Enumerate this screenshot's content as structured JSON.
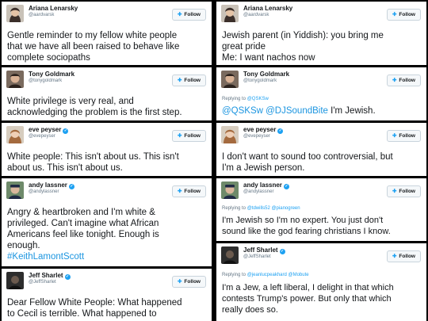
{
  "follow_label": "Follow",
  "left": [
    {
      "name": "Ariana Lenarsky",
      "handle": "@aardvarsk",
      "verified": false,
      "text_lines": [
        "Gentle reminder to my fellow white people",
        "that we have all been raised to behave like",
        "complete sociopaths"
      ]
    },
    {
      "name": "Tony Goldmark",
      "handle": "@tonygoldmark",
      "verified": false,
      "text_lines": [
        "White privilege is very real, and",
        "acknowledging the problem is the first step."
      ]
    },
    {
      "name": "eve peyser",
      "handle": "@evepeyser",
      "verified": true,
      "text_lines": [
        "White people: This isn't about us. This isn't",
        "about us. This isn't about us."
      ]
    },
    {
      "name": "andy lassner",
      "handle": "@andylassner",
      "verified": true,
      "text_lines": [
        "Angry & heartbroken and I'm white &",
        "privileged. Can't imagine what African",
        "Americans feel like tonight. Enough is",
        "enough."
      ],
      "hashtag": "#KeithLamontScott"
    },
    {
      "name": "Jeff Sharlet",
      "handle": "@JeffSharlet",
      "verified": true,
      "text_lines": [
        "Dear Fellow White People: What happened",
        "to Cecil is terrible. What happened to"
      ]
    }
  ],
  "right": [
    {
      "name": "Ariana Lenarsky",
      "handle": "@aardvarsk",
      "verified": false,
      "text_lines": [
        "Jewish parent (in Yiddish): you bring me",
        "great pride",
        "Me: I want nachos now"
      ]
    },
    {
      "name": "Tony Goldmark",
      "handle": "@tonygoldmark",
      "verified": false,
      "replying_prefix": "Replying to",
      "replying_mentions": "@QSKSw",
      "mentions": "@QSKSw @DJSoundBite",
      "text_after": "I'm Jewish."
    },
    {
      "name": "eve peyser",
      "handle": "@evepeyser",
      "verified": true,
      "text_lines": [
        "I don't want to sound too controversial, but",
        "I'm a Jewish person."
      ]
    },
    {
      "name": "andy lassner",
      "handle": "@andylassner",
      "verified": true,
      "replying_prefix": "Replying to",
      "replying_mentions": "@tdwills52 @pianogreen",
      "text_lines": [
        "I'm Jewish so I'm no expert. You just don't",
        "sound like the god fearing christians I know."
      ]
    },
    {
      "name": "Jeff Sharlet",
      "handle": "@JeffSharlet",
      "verified": true,
      "replying_prefix": "Replying to",
      "replying_mentions": "@jeanlucpeakhard @Mobute",
      "text_lines": [
        "I'm a Jew, a left liberal, I delight in that which",
        "contests Trump's power. But only that which",
        "really does so."
      ]
    }
  ],
  "colors": {
    "link": "#1b95e0",
    "verified": "#1da1f2",
    "handle": "#657786",
    "text": "#14171a",
    "divider": "#000000"
  },
  "avatar_icons": [
    "woman-avatar-icon",
    "man-avatar-icon",
    "woman-avatar-icon",
    "man-avatar-icon",
    "dark-avatar-icon"
  ]
}
